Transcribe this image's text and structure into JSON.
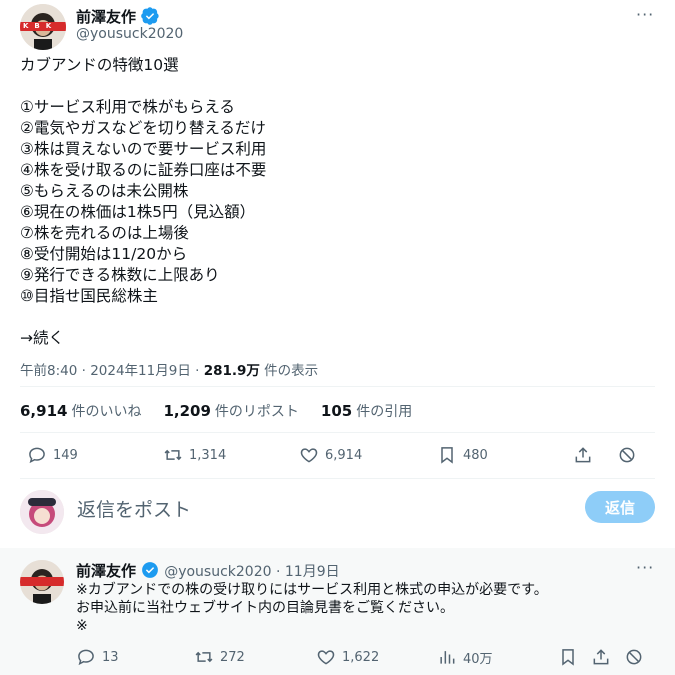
{
  "tweet": {
    "author_name": "前澤友作",
    "author_handle": "@yousuck2020",
    "avatar_badge": "KBK",
    "text": "カブアンドの特徴10選\n\n①サービス利用で株がもらえる\n②電気やガスなどを切り替えるだけ\n③株は買えないので要サービス利用\n④株を受け取るのに証券口座は不要\n⑤もらえるのは未公開株\n⑥現在の株価は1株5円（見込額）\n⑦株を売れるのは上場後\n⑧受付開始は11/20から\n⑨発行できる株数に上限あり\n⑩目指せ国民総株主\n\n→続く",
    "timestamp": "午前8:40 · 2024年11月9日 · ",
    "views_value": "281.9万",
    "views_label": " 件の表示",
    "more_icon": "more-horizontal-icon"
  },
  "stats": {
    "likes_num": "6,914",
    "likes_label": "件のいいね",
    "reposts_num": "1,209",
    "reposts_label": "件のリポスト",
    "quotes_num": "105",
    "quotes_label": "件の引用"
  },
  "actions": {
    "reply_count": "149",
    "repost_count": "1,314",
    "like_count": "6,914",
    "bookmark_count": "480"
  },
  "composer": {
    "placeholder": "返信をポスト",
    "button_label": "返信"
  },
  "reply": {
    "author_name": "前澤友作",
    "author_handle": "@yousuck2020 · 11月9日",
    "text": "※カブアンドでの株の受け取りにはサービス利用と株式の申込が必要です。\nお申込前に当社ウェブサイト内の目論見書をご覧ください。\n※",
    "reply_count": "13",
    "repost_count": "272",
    "like_count": "1,622",
    "views_count": "40万"
  },
  "colors": {
    "verified": "#1d9bf0",
    "secondary": "#536471",
    "reply_button": "#8ecdf8"
  }
}
